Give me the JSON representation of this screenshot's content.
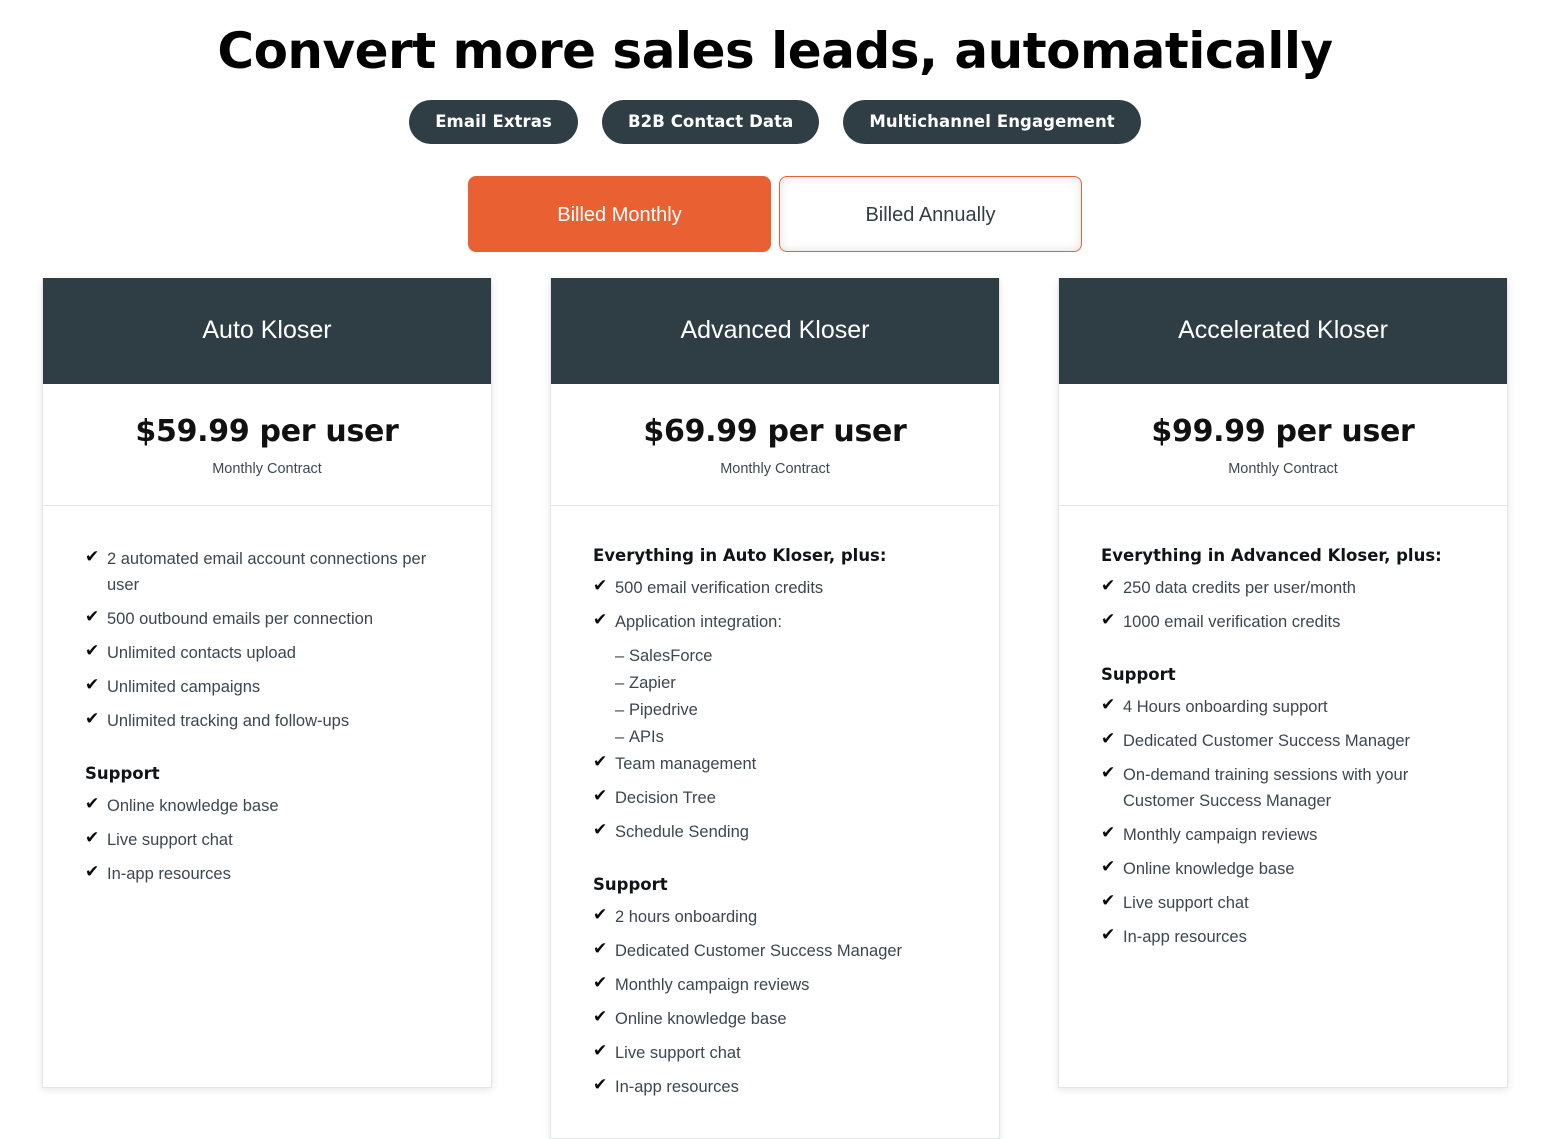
{
  "hero": {
    "title": "Convert more sales leads, automatically",
    "pills": [
      {
        "label": "Email Extras"
      },
      {
        "label": "B2B Contact Data"
      },
      {
        "label": "Multichannel Engagement"
      }
    ]
  },
  "billing_toggle": {
    "monthly_label": "Billed Monthly",
    "annually_label": "Billed Annually",
    "selected": "Billed Monthly",
    "active_color": "#e96133",
    "border_color": "#e96133"
  },
  "theme": {
    "header_bg": "#2f3e44",
    "accent": "#e96133",
    "card_border": "#e4e6e7",
    "body_text": "#3b4750"
  },
  "plans": [
    {
      "name": "Auto Kloser",
      "price": "$59.99 per user",
      "term": "Monthly Contract",
      "intro_heading": "",
      "features": [
        {
          "icon": "check-icon",
          "text": "2 automated email account connections per user"
        },
        {
          "icon": "check-icon",
          "text": "500 outbound emails per connection"
        },
        {
          "icon": "check-icon",
          "text": "Unlimited contacts upload"
        },
        {
          "icon": "check-icon",
          "text": "Unlimited campaigns"
        },
        {
          "icon": "check-icon",
          "text": "Unlimited tracking and follow-ups"
        }
      ],
      "support_heading": "Support",
      "support": [
        {
          "icon": "check-icon",
          "text": "Online knowledge base"
        },
        {
          "icon": "check-icon",
          "text": "Live support chat"
        },
        {
          "icon": "check-icon",
          "text": "In-app resources"
        }
      ]
    },
    {
      "name": "Advanced Kloser",
      "price": "$69.99 per user",
      "term": "Monthly Contract",
      "intro_heading": "Everything in Auto Kloser, plus:",
      "features": [
        {
          "icon": "check-icon",
          "text": "500 email verification credits"
        },
        {
          "icon": "check-icon",
          "text": "Application integration:",
          "sub_items": [
            {
              "dash": "–",
              "text": "SalesForce"
            },
            {
              "dash": "–",
              "text": "Zapier"
            },
            {
              "dash": "–",
              "text": "Pipedrive"
            },
            {
              "dash": "–",
              "text": "APIs"
            }
          ]
        },
        {
          "icon": "check-icon",
          "text": "Team management"
        },
        {
          "icon": "check-icon",
          "text": "Decision Tree"
        },
        {
          "icon": "check-icon",
          "text": "Schedule Sending"
        }
      ],
      "support_heading": "Support",
      "support": [
        {
          "icon": "check-icon",
          "text": "2 hours onboarding"
        },
        {
          "icon": "check-icon",
          "text": "Dedicated Customer Success Manager"
        },
        {
          "icon": "check-icon",
          "text": "Monthly campaign reviews"
        },
        {
          "icon": "check-icon",
          "text": "Online knowledge base"
        },
        {
          "icon": "check-icon",
          "text": "Live support chat"
        },
        {
          "icon": "check-icon",
          "text": "In-app resources"
        }
      ]
    },
    {
      "name": "Accelerated Kloser",
      "price": "$99.99 per user",
      "term": "Monthly Contract",
      "intro_heading": "Everything in Advanced Kloser, plus:",
      "features": [
        {
          "icon": "check-icon",
          "text": "250 data credits per user/month"
        },
        {
          "icon": "check-icon",
          "text": "1000 email verification credits"
        }
      ],
      "support_heading": "Support",
      "support": [
        {
          "icon": "check-icon",
          "text": "4 Hours onboarding support"
        },
        {
          "icon": "check-icon",
          "text": "Dedicated Customer Success Manager"
        },
        {
          "icon": "check-icon",
          "text": "On-demand training sessions with your Customer Success Manager"
        },
        {
          "icon": "check-icon",
          "text": "Monthly campaign reviews"
        },
        {
          "icon": "check-icon",
          "text": "Online knowledge base"
        },
        {
          "icon": "check-icon",
          "text": "Live support chat"
        },
        {
          "icon": "check-icon",
          "text": "In-app resources"
        }
      ]
    }
  ],
  "icons": {
    "check": "✔"
  }
}
